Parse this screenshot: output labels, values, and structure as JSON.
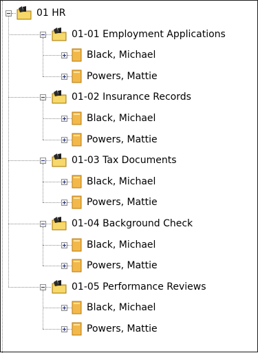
{
  "root": {
    "label": "01 HR",
    "folders": [
      {
        "label": "01-01 Employment Applications",
        "items": [
          "Black, Michael",
          "Powers, Mattie"
        ]
      },
      {
        "label": "01-02 Insurance Records",
        "items": [
          "Black, Michael",
          "Powers, Mattie"
        ]
      },
      {
        "label": "01-03 Tax Documents",
        "items": [
          "Black, Michael",
          "Powers, Mattie"
        ]
      },
      {
        "label": "01-04 Background Check",
        "items": [
          "Black, Michael",
          "Powers, Mattie"
        ]
      },
      {
        "label": "01-05 Performance Reviews",
        "items": [
          "Black, Michael",
          "Powers, Mattie"
        ]
      }
    ]
  }
}
